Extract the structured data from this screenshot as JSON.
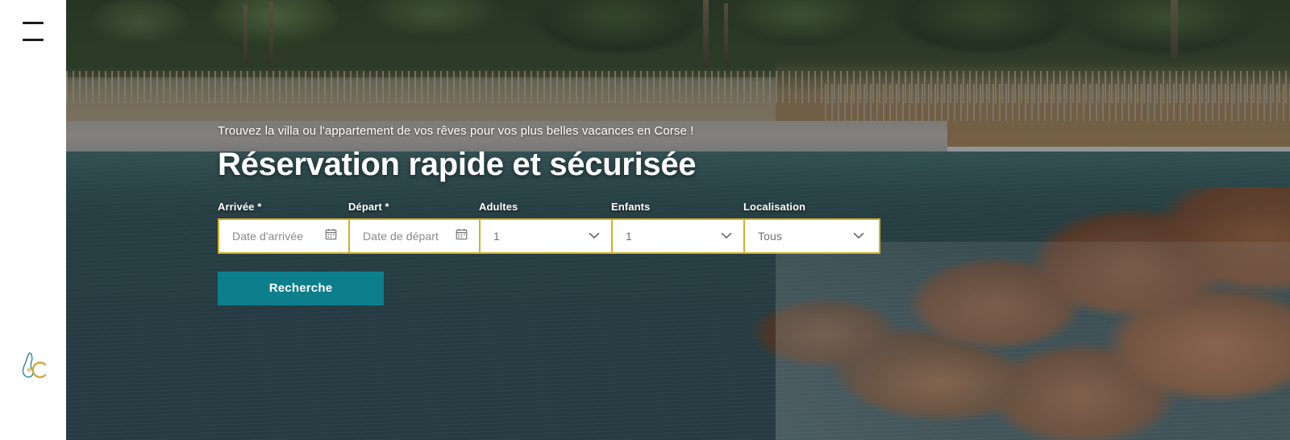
{
  "colors": {
    "accent_teal": "#0d7f8c",
    "border_gold": "#d4b02a",
    "text_white": "#ffffff",
    "placeholder_grey": "#8a8a8a"
  },
  "sidebar": {
    "menu_label": "Menu",
    "logo_label": "Corsica logo"
  },
  "hero": {
    "kicker": "Trouvez la villa ou l'appartement de vos rêves pour vos plus belles vacances en Corse !",
    "headline": "Réservation rapide et sécurisée"
  },
  "search_form": {
    "fields": [
      {
        "name": "arrivee",
        "label": "Arrivée",
        "required_marker": "*",
        "type": "date",
        "placeholder": "Date d'arrivée",
        "value": "",
        "icon": "calendar-icon"
      },
      {
        "name": "depart",
        "label": "Départ",
        "required_marker": "*",
        "type": "date",
        "placeholder": "Date de départ",
        "value": "",
        "icon": "calendar-icon"
      },
      {
        "name": "adultes",
        "label": "Adultes",
        "required_marker": "",
        "type": "select",
        "placeholder": "",
        "value": "1",
        "icon": "chevron-down-icon"
      },
      {
        "name": "enfants",
        "label": "Enfants",
        "required_marker": "",
        "type": "select",
        "placeholder": "",
        "value": "1",
        "icon": "chevron-down-icon"
      },
      {
        "name": "localisation",
        "label": "Localisation",
        "required_marker": "",
        "type": "select",
        "placeholder": "",
        "value": "Tous",
        "icon": "chevron-down-icon"
      }
    ],
    "submit_label": "Recherche"
  }
}
